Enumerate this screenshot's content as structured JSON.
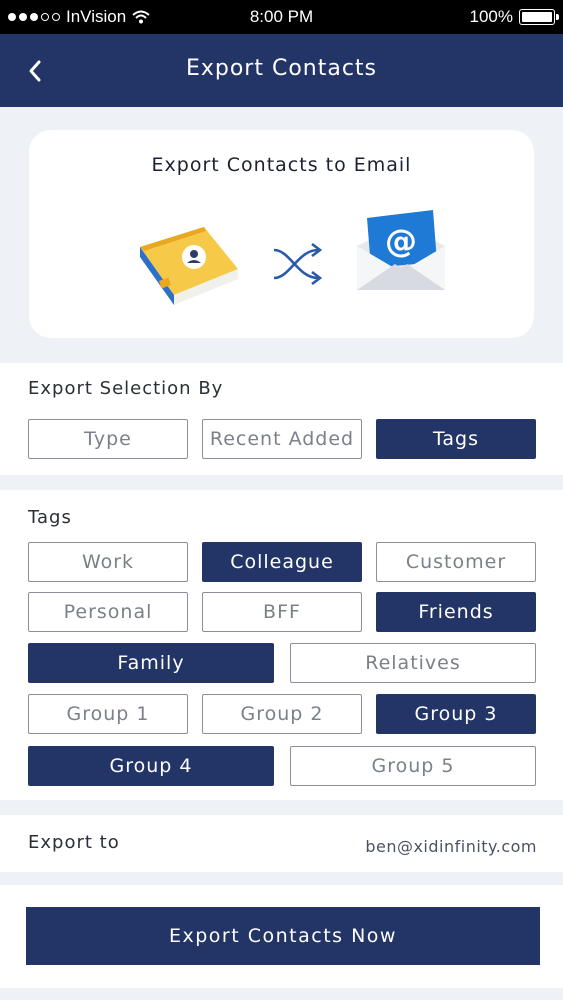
{
  "status_bar": {
    "carrier": "InVision",
    "time": "8:00 PM",
    "battery_text": "100%",
    "battery_level": 1.0
  },
  "nav": {
    "title": "Export Contacts",
    "back_icon": "chevron-left-icon"
  },
  "hero": {
    "title": "Export Contacts to Email",
    "icons": [
      "address-book-icon",
      "shuffle-arrows-icon",
      "email-envelope-icon"
    ]
  },
  "selection": {
    "label": "Export Selection By",
    "options": [
      {
        "label": "Type",
        "selected": false
      },
      {
        "label": "Recent Added",
        "selected": false
      },
      {
        "label": "Tags",
        "selected": true
      }
    ]
  },
  "tags": {
    "label": "Tags",
    "items": [
      {
        "label": "Work",
        "selected": false
      },
      {
        "label": "Colleague",
        "selected": true
      },
      {
        "label": "Customer",
        "selected": false
      },
      {
        "label": "Personal",
        "selected": false
      },
      {
        "label": "BFF",
        "selected": false
      },
      {
        "label": "Friends",
        "selected": true
      },
      {
        "label": "Family",
        "selected": true
      },
      {
        "label": "Relatives",
        "selected": false
      },
      {
        "label": "Group 1",
        "selected": false
      },
      {
        "label": "Group 2",
        "selected": false
      },
      {
        "label": "Group 3",
        "selected": true
      },
      {
        "label": "Group 4",
        "selected": true
      },
      {
        "label": "Group 5",
        "selected": false
      }
    ]
  },
  "export_to": {
    "label": "Export to",
    "email": "ben@xidinfinity.com"
  },
  "action": {
    "label": "Export Contacts Now"
  },
  "colors": {
    "primary": "#233466",
    "background": "#eef1f6",
    "chip_border": "#8a8f99"
  }
}
